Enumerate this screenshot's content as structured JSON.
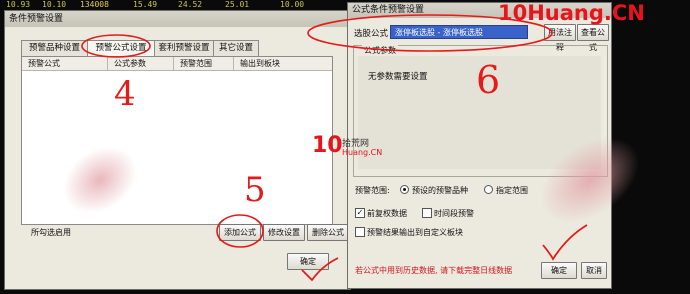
{
  "ticker": [
    "10.93",
    "10.10",
    "134008",
    "15.49",
    "24.52",
    "25.01",
    "10.00"
  ],
  "watermark": "10Huang.CN",
  "logo": {
    "mark": "10",
    "cn": "拾荒网",
    "en": "Huang.CN"
  },
  "main_window": {
    "title": "条件预警设置",
    "tabs": [
      {
        "label": "预警品种设置"
      },
      {
        "label": "预警公式设置"
      },
      {
        "label": "套利预警设置"
      },
      {
        "label": "其它设置"
      }
    ],
    "columns": [
      "预警公式",
      "公式参数",
      "预警范围",
      "输出到板块"
    ],
    "enable_label": "所勾选启用",
    "buttons": {
      "add": "添加公式",
      "edit": "修改设置",
      "delete": "删除公式",
      "ok": "确定"
    }
  },
  "formula_dialog": {
    "title": "公式条件预警设置",
    "select_label": "选股公式",
    "selected_formula": "涨停板选股 - 涨停板选股",
    "buttons": {
      "annotate": "用法注释",
      "view": "查看公式",
      "ok": "确定",
      "cancel": "取消"
    },
    "params_group": "公式参数",
    "no_params": "无参数需要设置",
    "range_label": "预警范围:",
    "range_options": [
      {
        "label": "预设的预警品种",
        "selected": true
      },
      {
        "label": "指定范围",
        "selected": false
      }
    ],
    "checkboxes": [
      {
        "label": "前复权数据",
        "checked": true
      },
      {
        "label": "时间段预警",
        "checked": false
      },
      {
        "label": "预警结果输出到自定义板块",
        "checked": false
      }
    ],
    "note": "若公式中用到历史数据, 请下载完整日线数据"
  },
  "annotations": {
    "step4": "4",
    "step5": "5",
    "step6": "6"
  },
  "colors": {
    "watermark": "#e8141c",
    "annotation": "#e51a1a",
    "selection": "#3a63c9",
    "note": "#d01818"
  }
}
